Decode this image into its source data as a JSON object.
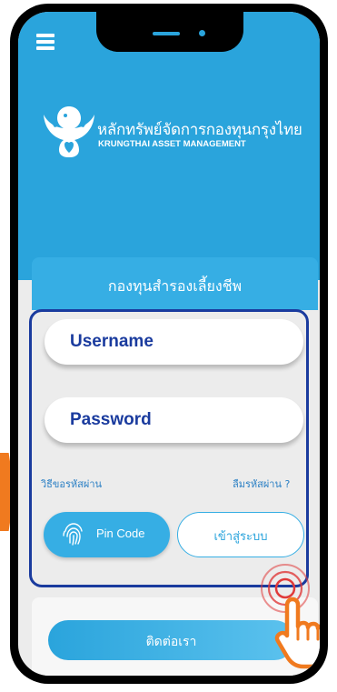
{
  "menu": {
    "icon": "hamburger-menu-icon"
  },
  "brand": {
    "name_th": "หลักทรัพย์จัดการกองทุนกรุงไทย",
    "name_en": "KRUNGTHAI ASSET MANAGEMENT",
    "logo": "garuda-logo"
  },
  "section": {
    "title": "กองทุนสำรองเลี้ยงชีพ"
  },
  "login": {
    "username_placeholder": "Username",
    "password_placeholder": "Password",
    "request_password_link": "วิธีขอรหัสผ่าน",
    "forgot_password_link": "ลืมรหัสผ่าน ?",
    "pin_button_label": "Pin Code",
    "pin_icon": "fingerprint-icon",
    "login_button_label": "เข้าสู่ระบบ"
  },
  "contact": {
    "button_label": "ติดต่อเรา"
  },
  "colors": {
    "primary": "#2aa4dc",
    "highlight_border": "#1a3b9e",
    "arrow": "#f07a1f",
    "pointer_hand": "#f07a1f",
    "tap_ring": "#e03a3a"
  }
}
